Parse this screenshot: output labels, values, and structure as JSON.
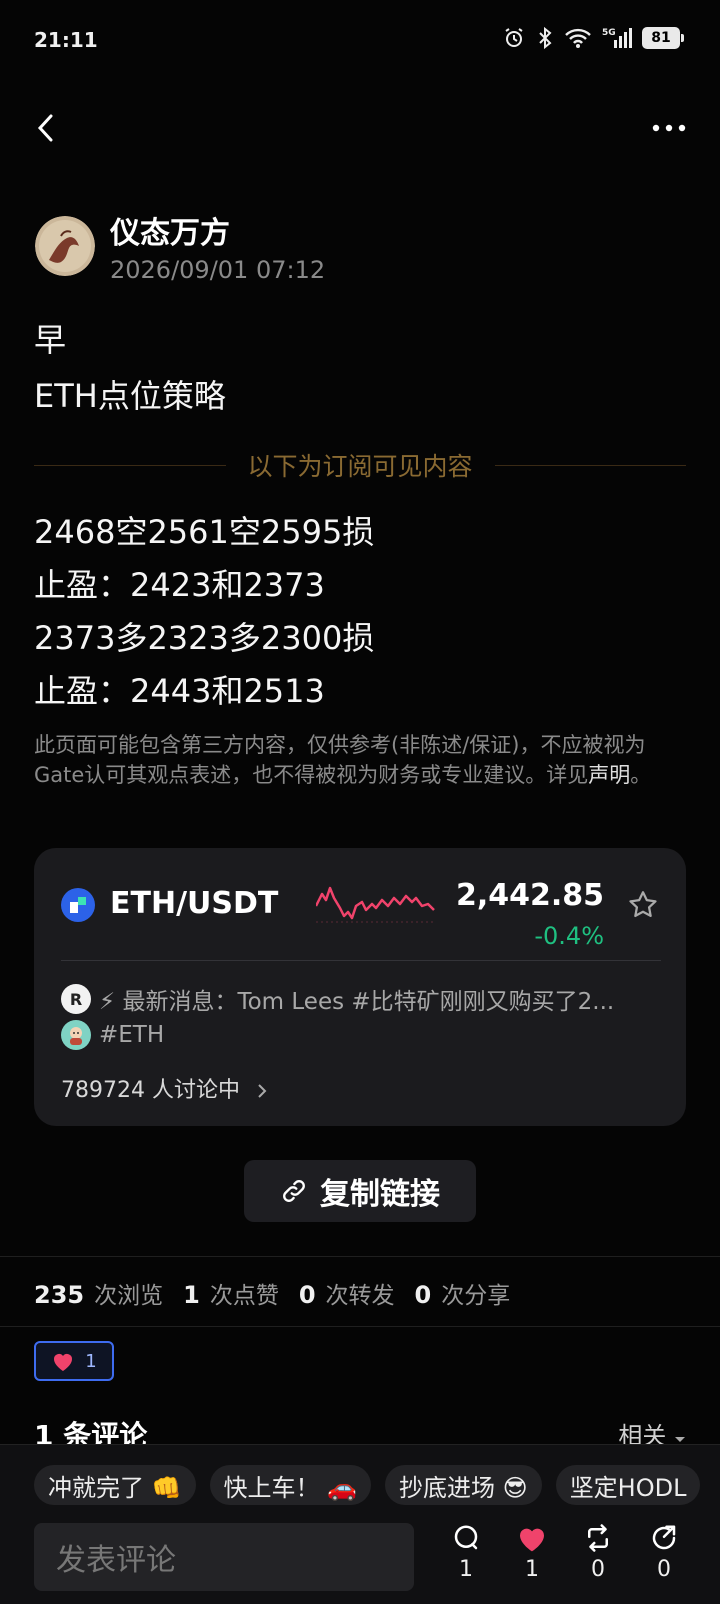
{
  "status_bar": {
    "time": "21:11",
    "network": "5G",
    "battery": "81"
  },
  "author": {
    "name": "仪态万方",
    "time": "2026/09/01 07:12"
  },
  "post": {
    "title_lines": [
      "早",
      "ETH点位策略"
    ],
    "subscriber_divider": "以下为订阅可见内容",
    "body_lines": [
      "2468空2561空2595损",
      "止盈：2423和2373",
      "2373多2323多2300损",
      "止盈：2443和2513"
    ],
    "disclaimer": "此页面可能包含第三方内容，仅供参考(非陈述/保证)，不应被视为Gate认可其观点表述，也不得被视为财务或专业建议。详见",
    "disclaimer_link": "声明",
    "disclaimer_end": "。"
  },
  "market_card": {
    "pair": "ETH/USDT",
    "price": "2,442.85",
    "change": "-0.4%",
    "change_color": "#1fc081",
    "news_badge": "R",
    "news": "⚡ 最新消息：Tom Lees #比特矿刚刚又购买了2...",
    "tag": "#ETH",
    "discussing": "789724 人讨论中"
  },
  "copy_link_label": "复制链接",
  "stats": {
    "views": "235",
    "views_label": "次浏览",
    "likes": "1",
    "likes_label": "次点赞",
    "reposts": "0",
    "reposts_label": "次转发",
    "shares": "0",
    "shares_label": "次分享"
  },
  "reaction": {
    "count": "1"
  },
  "comments": {
    "title": "1 条评论",
    "sort": "相关"
  },
  "quick_replies": [
    "冲就完了 👊",
    "快上车！ 🚗",
    "抄底进场 😎",
    "坚定HODL"
  ],
  "bottom_bar": {
    "input_placeholder": "发表评论",
    "comment_count": "1",
    "like_count": "1",
    "repost_count": "0",
    "share_count": "0"
  }
}
